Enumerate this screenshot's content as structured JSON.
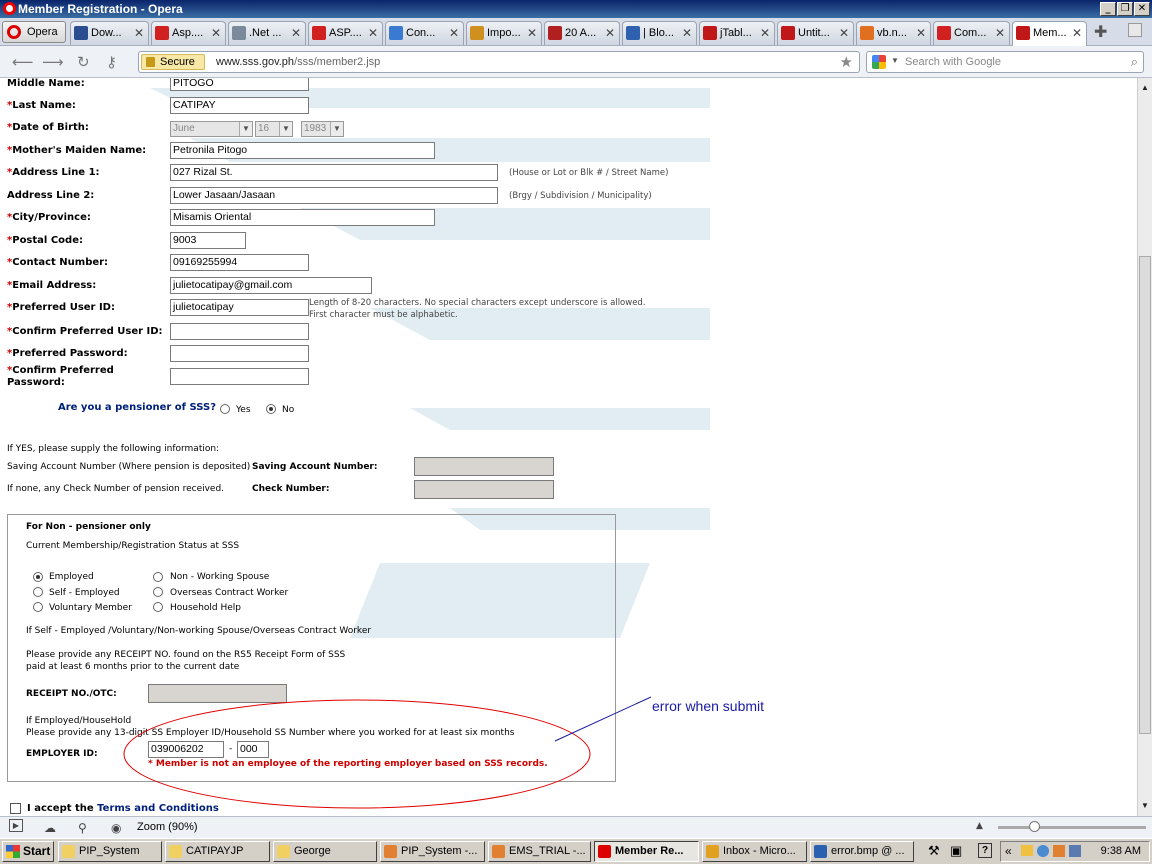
{
  "window": {
    "title": "Member Registration - Opera"
  },
  "tabs": [
    {
      "label": "Opera"
    },
    {
      "label": "Dow...",
      "color": "#2a4d8f"
    },
    {
      "label": "Asp....",
      "color": "#d02020"
    },
    {
      "label": ".Net ...",
      "color": "#7a8a9a"
    },
    {
      "label": "ASP....",
      "color": "#d02020"
    },
    {
      "label": "Con...",
      "color": "#3a7ad0"
    },
    {
      "label": "Impo...",
      "color": "#d09020"
    },
    {
      "label": "20 A...",
      "color": "#b02020"
    },
    {
      "label": "| Blo...",
      "color": "#3060b0"
    },
    {
      "label": "jTabl...",
      "color": "#c01818"
    },
    {
      "label": "Untit...",
      "color": "#c01818"
    },
    {
      "label": "vb.n...",
      "color": "#e07020"
    },
    {
      "label": "Com...",
      "color": "#d02020"
    },
    {
      "label": "Mem...",
      "color": "#c01818"
    }
  ],
  "address": {
    "secure_label": "Secure",
    "host": "www.sss.gov.ph",
    "path": "/sss/member2.jsp",
    "search_placeholder": "Search with Google"
  },
  "form": {
    "middle_name": {
      "label": "Middle Name:",
      "value": "PITOGO"
    },
    "last_name": {
      "label": "Last Name:",
      "value": "CATIPAY"
    },
    "dob": {
      "label": "Date of Birth:",
      "month": "June",
      "day": "16",
      "year": "1983"
    },
    "maiden": {
      "label": "Mother's Maiden Name:",
      "value": "Petronila  Pitogo"
    },
    "addr1": {
      "label": "Address Line 1:",
      "value": "027 Rizal  St.",
      "hint": "(House or Lot or Blk # / Street Name)"
    },
    "addr2": {
      "label": "Address Line 2:",
      "value": "Lower  Jasaan/Jasaan",
      "hint": "(Brgy  / Subdivision / Municipality)"
    },
    "city": {
      "label": "City/Province:",
      "value": "Misamis  Oriental"
    },
    "postal": {
      "label": "Postal Code:",
      "value": "9003"
    },
    "contact": {
      "label": "Contact Number:",
      "value": "09169255994"
    },
    "email": {
      "label": "Email Address:",
      "value": "julietocatipay@gmail.com"
    },
    "userid": {
      "label": "Preferred User ID:",
      "value": "julietocatipay",
      "hint1": "Length of 8-20 characters. No special characters except underscore is allowed.",
      "hint2": "First character must be  alphabetic."
    },
    "confirm_userid": {
      "label": "Confirm Preferred User ID:"
    },
    "password": {
      "label": "Preferred Password:"
    },
    "confirm_password": {
      "label1": "Confirm Preferred",
      "label2": "Password:"
    },
    "pensioner": {
      "question": "Are you a pensioner of SSS?",
      "yes": "Yes",
      "no": "No",
      "selected": "No"
    },
    "pension_info": {
      "intro": "If YES, please supply the following information:",
      "saving_desc": "Saving Account Number (Where pension is deposited)",
      "saving_label": "Saving Account Number:",
      "check_desc": "If none, any Check Number of pension received.",
      "check_label": "Check Number:"
    },
    "non_pensioner": {
      "title": "For Non - pensioner only",
      "subtitle": "Current Membership/Registration Status at SSS",
      "options": [
        "Employed",
        "Self - Employed",
        "Voluntary Member",
        "Non - Working Spouse",
        "Overseas Contract Worker",
        "Household Help"
      ],
      "selected": "Employed",
      "self_note": "If Self - Employed /Voluntary/Non-working Spouse/Overseas Contract Worker",
      "receipt_note1": "Please provide any RECEIPT NO. found on the RS5 Receipt Form of SSS",
      "receipt_note2": "paid at least 6 months prior to the current date",
      "receipt_label": "RECEIPT NO./OTC:",
      "employed_note1": "If Employed/HouseHold",
      "employed_note2": "Please provide any 13-digit SS Employer ID/Household SS Number where you worked for at least six months",
      "employer_label": "EMPLOYER ID:",
      "employer_id": "039006202",
      "employer_sep": "-",
      "employer_branch": "000",
      "error_star": "*",
      "error": "Member is not an employee of the reporting employer based on SSS records."
    },
    "terms": {
      "prefix": "I accept the ",
      "link": "Terms and Conditions"
    }
  },
  "annotation": {
    "text": "error when submit",
    "color": "#1a1aa0",
    "ellipse_color": "#e00000"
  },
  "statusbar": {
    "zoom": "Zoom (90%)"
  },
  "taskbar": {
    "start": "Start",
    "items": [
      "PIP_System",
      "CATIPAYJP",
      "George",
      "PIP_System -...",
      "EMS_TRIAL -...",
      "Member Re...",
      "Inbox - Micro...",
      "error.bmp @ ..."
    ],
    "clock": "9:38 AM"
  }
}
